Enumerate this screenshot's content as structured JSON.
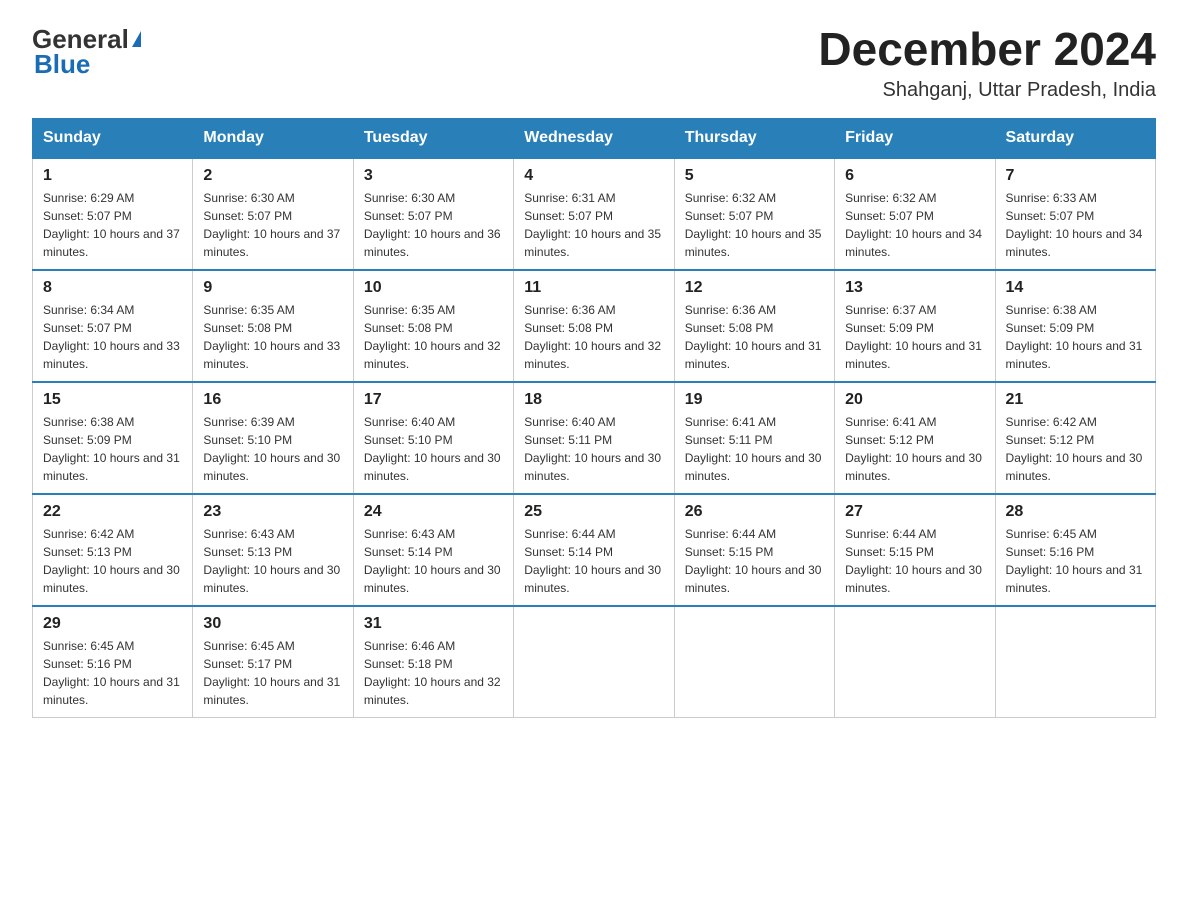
{
  "header": {
    "logo_general": "General",
    "logo_blue": "Blue",
    "month_year": "December 2024",
    "location": "Shahganj, Uttar Pradesh, India"
  },
  "days_of_week": [
    "Sunday",
    "Monday",
    "Tuesday",
    "Wednesday",
    "Thursday",
    "Friday",
    "Saturday"
  ],
  "weeks": [
    [
      {
        "day": 1,
        "sunrise": "6:29 AM",
        "sunset": "5:07 PM",
        "daylight": "10 hours and 37 minutes."
      },
      {
        "day": 2,
        "sunrise": "6:30 AM",
        "sunset": "5:07 PM",
        "daylight": "10 hours and 37 minutes."
      },
      {
        "day": 3,
        "sunrise": "6:30 AM",
        "sunset": "5:07 PM",
        "daylight": "10 hours and 36 minutes."
      },
      {
        "day": 4,
        "sunrise": "6:31 AM",
        "sunset": "5:07 PM",
        "daylight": "10 hours and 35 minutes."
      },
      {
        "day": 5,
        "sunrise": "6:32 AM",
        "sunset": "5:07 PM",
        "daylight": "10 hours and 35 minutes."
      },
      {
        "day": 6,
        "sunrise": "6:32 AM",
        "sunset": "5:07 PM",
        "daylight": "10 hours and 34 minutes."
      },
      {
        "day": 7,
        "sunrise": "6:33 AM",
        "sunset": "5:07 PM",
        "daylight": "10 hours and 34 minutes."
      }
    ],
    [
      {
        "day": 8,
        "sunrise": "6:34 AM",
        "sunset": "5:07 PM",
        "daylight": "10 hours and 33 minutes."
      },
      {
        "day": 9,
        "sunrise": "6:35 AM",
        "sunset": "5:08 PM",
        "daylight": "10 hours and 33 minutes."
      },
      {
        "day": 10,
        "sunrise": "6:35 AM",
        "sunset": "5:08 PM",
        "daylight": "10 hours and 32 minutes."
      },
      {
        "day": 11,
        "sunrise": "6:36 AM",
        "sunset": "5:08 PM",
        "daylight": "10 hours and 32 minutes."
      },
      {
        "day": 12,
        "sunrise": "6:36 AM",
        "sunset": "5:08 PM",
        "daylight": "10 hours and 31 minutes."
      },
      {
        "day": 13,
        "sunrise": "6:37 AM",
        "sunset": "5:09 PM",
        "daylight": "10 hours and 31 minutes."
      },
      {
        "day": 14,
        "sunrise": "6:38 AM",
        "sunset": "5:09 PM",
        "daylight": "10 hours and 31 minutes."
      }
    ],
    [
      {
        "day": 15,
        "sunrise": "6:38 AM",
        "sunset": "5:09 PM",
        "daylight": "10 hours and 31 minutes."
      },
      {
        "day": 16,
        "sunrise": "6:39 AM",
        "sunset": "5:10 PM",
        "daylight": "10 hours and 30 minutes."
      },
      {
        "day": 17,
        "sunrise": "6:40 AM",
        "sunset": "5:10 PM",
        "daylight": "10 hours and 30 minutes."
      },
      {
        "day": 18,
        "sunrise": "6:40 AM",
        "sunset": "5:11 PM",
        "daylight": "10 hours and 30 minutes."
      },
      {
        "day": 19,
        "sunrise": "6:41 AM",
        "sunset": "5:11 PM",
        "daylight": "10 hours and 30 minutes."
      },
      {
        "day": 20,
        "sunrise": "6:41 AM",
        "sunset": "5:12 PM",
        "daylight": "10 hours and 30 minutes."
      },
      {
        "day": 21,
        "sunrise": "6:42 AM",
        "sunset": "5:12 PM",
        "daylight": "10 hours and 30 minutes."
      }
    ],
    [
      {
        "day": 22,
        "sunrise": "6:42 AM",
        "sunset": "5:13 PM",
        "daylight": "10 hours and 30 minutes."
      },
      {
        "day": 23,
        "sunrise": "6:43 AM",
        "sunset": "5:13 PM",
        "daylight": "10 hours and 30 minutes."
      },
      {
        "day": 24,
        "sunrise": "6:43 AM",
        "sunset": "5:14 PM",
        "daylight": "10 hours and 30 minutes."
      },
      {
        "day": 25,
        "sunrise": "6:44 AM",
        "sunset": "5:14 PM",
        "daylight": "10 hours and 30 minutes."
      },
      {
        "day": 26,
        "sunrise": "6:44 AM",
        "sunset": "5:15 PM",
        "daylight": "10 hours and 30 minutes."
      },
      {
        "day": 27,
        "sunrise": "6:44 AM",
        "sunset": "5:15 PM",
        "daylight": "10 hours and 30 minutes."
      },
      {
        "day": 28,
        "sunrise": "6:45 AM",
        "sunset": "5:16 PM",
        "daylight": "10 hours and 31 minutes."
      }
    ],
    [
      {
        "day": 29,
        "sunrise": "6:45 AM",
        "sunset": "5:16 PM",
        "daylight": "10 hours and 31 minutes."
      },
      {
        "day": 30,
        "sunrise": "6:45 AM",
        "sunset": "5:17 PM",
        "daylight": "10 hours and 31 minutes."
      },
      {
        "day": 31,
        "sunrise": "6:46 AM",
        "sunset": "5:18 PM",
        "daylight": "10 hours and 32 minutes."
      },
      null,
      null,
      null,
      null
    ]
  ]
}
